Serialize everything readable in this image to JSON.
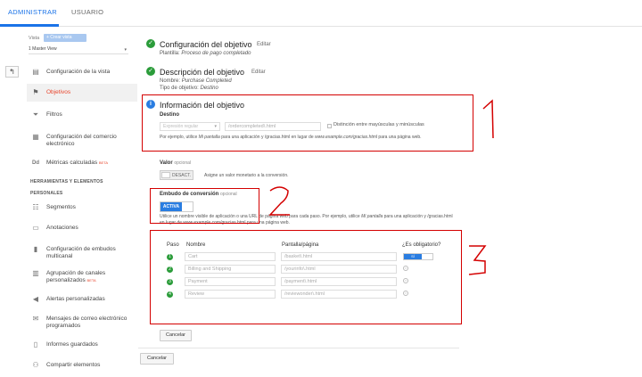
{
  "tabs": {
    "admin": "ADMINISTRAR",
    "user": "USUARIO"
  },
  "sidebar": {
    "vista_label": "Vista",
    "new_view": "+ Crear vista",
    "view_selected": "1 Master View",
    "items": [
      {
        "label": "Configuración de la vista",
        "icon": "document-icon"
      },
      {
        "label": "Objetivos",
        "icon": "flag-icon"
      },
      {
        "label": "Filtros",
        "icon": "filter-icon"
      },
      {
        "label": "Configuración del comercio electrónico",
        "icon": "cart-icon"
      },
      {
        "label": "Métricas calculadas",
        "badge": "BETA",
        "icon": "dd-icon"
      }
    ],
    "section_tools": "HERRAMIENTAS Y ELEMENTOS",
    "section_personal": "PERSONALES",
    "tools": [
      {
        "label": "Segmentos",
        "icon": "segments-icon"
      },
      {
        "label": "Anotaciones",
        "icon": "annotation-icon"
      },
      {
        "label": "Configuración de embudos multicanal",
        "icon": "bar-chart-icon"
      },
      {
        "label": "Agrupación de canales personalizados",
        "badge": "BETA",
        "icon": "grouping-icon"
      },
      {
        "label": "Alertas personalizadas",
        "icon": "megaphone-icon"
      },
      {
        "label": "Mensajes de correo electrónico programados",
        "icon": "mail-icon"
      },
      {
        "label": "Informes guardados",
        "icon": "saved-report-icon"
      },
      {
        "label": "Compartir elementos",
        "icon": "share-user-icon"
      }
    ]
  },
  "goal": {
    "step1_title": "Configuración del objetivo",
    "step1_sub_label": "Plantilla:",
    "step1_sub_value": "Proceso de pago completado",
    "step2_title": "Descripción del objetivo",
    "step2_name_label": "Nombre:",
    "step2_name_value": "Purchase Completed",
    "step2_type_label": "Tipo de objetivo:",
    "step2_type_value": "Destino",
    "edit": "Editar",
    "step3_title": "Información del objetivo",
    "destino_label": "Destino",
    "match_type": "Expresión regular",
    "destino_value": "/ordercompleted\\.html",
    "case_label": "Distinción entre mayúsculas y minúsculas",
    "destino_help_1": "Por ejemplo, utilice ",
    "destino_help_i1": "Mi pantalla",
    "destino_help_2": " para una aplicación y /gracias.html en lugar de ",
    "destino_help_i2": "www.example.com/gracias.html",
    "destino_help_3": " para una página web.",
    "valor_label": "Valor",
    "optional": "opcional",
    "valor_toggle": "DESACT.",
    "valor_help": "Asigne un valor monetario a la conversión.",
    "funnel_label": "Embudo de conversión",
    "funnel_toggle": "ACTIVA",
    "funnel_help_1": "Utilice un nombre visible de aplicación o una URL de página web para cada paso. Por ejemplo, utilice ",
    "funnel_help_i1": "Mi pantalla",
    "funnel_help_2": " para una aplicación y /gracias.html en lugar de www.example.com/gracias.html para una página web.",
    "col_step": "Paso",
    "col_name": "Nombre",
    "col_page": "Pantalla/página",
    "col_required": "¿Es obligatorio?",
    "required_toggle": "SÍ",
    "steps": [
      {
        "num": "1",
        "name": "Cart",
        "page": "/basket\\.html"
      },
      {
        "num": "2",
        "name": "Billing and Shipping",
        "page": "/yourinfo\\.html"
      },
      {
        "num": "3",
        "name": "Payment",
        "page": "/payment\\.html"
      },
      {
        "num": "4",
        "name": "Review",
        "page": "/reviewonder\\.html"
      }
    ],
    "cancel_inner": "Cancelar",
    "cancel_outer": "Cancelar"
  },
  "colors": {
    "accent": "#1a73e8",
    "success": "#2b9c3a",
    "annotation": "#d40000",
    "active_item": "#e8452c"
  }
}
